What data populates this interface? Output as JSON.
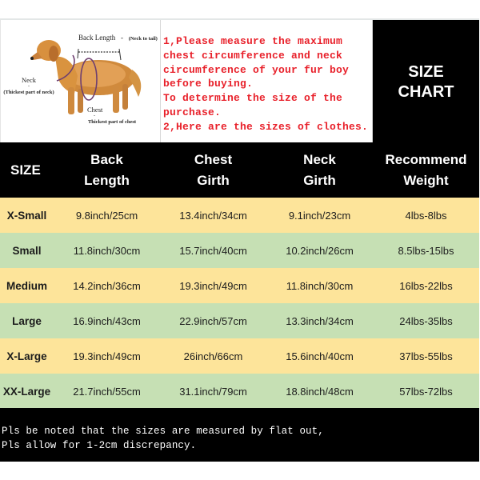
{
  "illustration": {
    "back_length_label": "Back Length",
    "back_length_dash": "-",
    "back_length_note": "(Neck to tail)",
    "neck_label": "Neck",
    "neck_dash": "-",
    "neck_note": "(Thickest part of neck)",
    "chest_label": "Chest",
    "chest_dash": "-",
    "chest_note": "Thickest part of chest"
  },
  "notes": {
    "text": "1,Please measure the maximum\nchest circumference and neck\ncircumference of your fur boy\nbefore buying.\nTo determine the size of the\npurchase.\n2,Here are the sizes of clothes."
  },
  "title": {
    "line1": "SIZE",
    "line2": "CHART"
  },
  "table": {
    "headers": [
      {
        "line1": "SIZE",
        "line2": ""
      },
      {
        "line1": "Back",
        "line2": "Length"
      },
      {
        "line1": "Chest",
        "line2": "Girth"
      },
      {
        "line1": "Neck",
        "line2": "Girth"
      },
      {
        "line1": "Recommend",
        "line2": "Weight"
      }
    ],
    "rows": [
      {
        "size": "X-Small",
        "back": "9.8inch/25cm",
        "chest": "13.4inch/34cm",
        "neck": "9.1inch/23cm",
        "weight": "4lbs-8lbs"
      },
      {
        "size": "Small",
        "back": "11.8inch/30cm",
        "chest": "15.7inch/40cm",
        "neck": "10.2inch/26cm",
        "weight": "8.5lbs-15lbs"
      },
      {
        "size": "Medium",
        "back": "14.2inch/36cm",
        "chest": "19.3inch/49cm",
        "neck": "11.8inch/30cm",
        "weight": "16lbs-22lbs"
      },
      {
        "size": "Large",
        "back": "16.9inch/43cm",
        "chest": "22.9inch/57cm",
        "neck": "13.3inch/34cm",
        "weight": "24lbs-35lbs"
      },
      {
        "size": "X-Large",
        "back": "19.3inch/49cm",
        "chest": "26inch/66cm",
        "neck": "15.6inch/40cm",
        "weight": "37lbs-55lbs"
      },
      {
        "size": "XX-Large",
        "back": "21.7inch/55cm",
        "chest": "31.1inch/79cm",
        "neck": "18.8inch/48cm",
        "weight": "57lbs-72lbs"
      }
    ]
  },
  "footer": {
    "line1": "Pls be noted that the sizes are measured by flat out,",
    "line2": "Pls allow for 1-2cm discrepancy."
  },
  "colors": {
    "row_yellow": "#fde49a",
    "row_green": "#c6e0b4",
    "notes_red": "#e8202a",
    "header_black": "#000000"
  }
}
